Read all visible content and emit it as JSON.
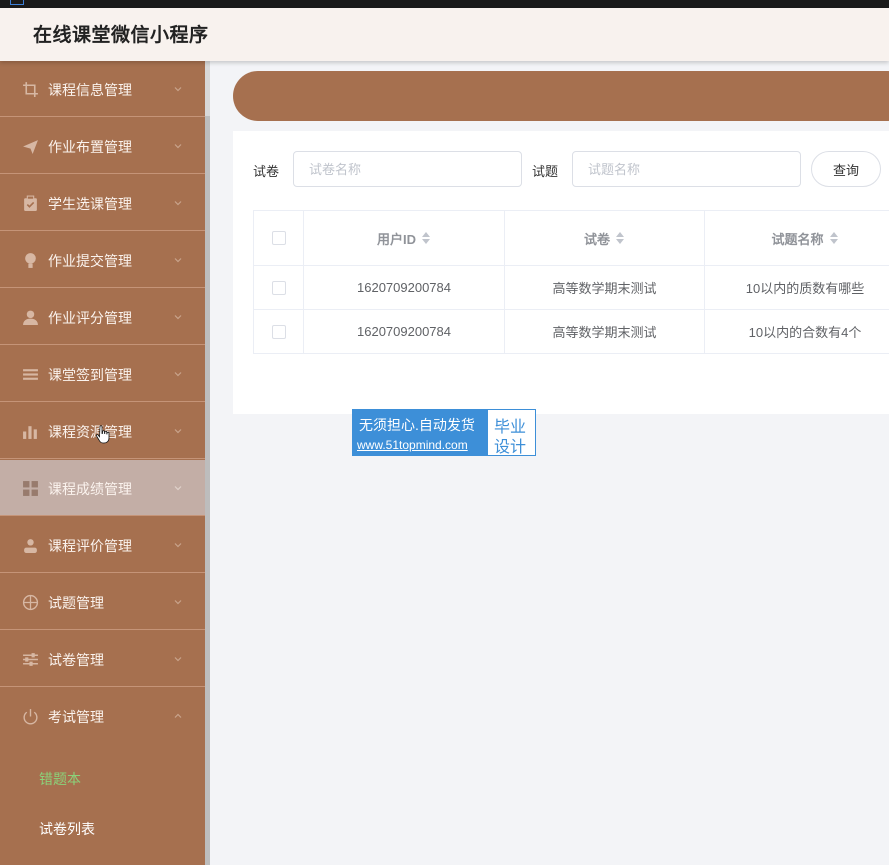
{
  "app": {
    "title": "在线课堂微信小程序"
  },
  "sidebar": {
    "items": [
      {
        "label": "课程信息管理",
        "icon": "crop-icon"
      },
      {
        "label": "作业布置管理",
        "icon": "send-icon"
      },
      {
        "label": "学生选课管理",
        "icon": "clipboard-icon"
      },
      {
        "label": "作业提交管理",
        "icon": "bulb-icon"
      },
      {
        "label": "作业评分管理",
        "icon": "user-icon"
      },
      {
        "label": "课堂签到管理",
        "icon": "list-icon"
      },
      {
        "label": "课程资源管理",
        "icon": "bar-chart-icon"
      },
      {
        "label": "课程成绩管理",
        "icon": "grid-icon"
      },
      {
        "label": "课程评价管理",
        "icon": "person-icon"
      },
      {
        "label": "试题管理",
        "icon": "target-icon"
      },
      {
        "label": "试卷管理",
        "icon": "sliders-icon"
      },
      {
        "label": "考试管理",
        "icon": "power-icon"
      }
    ],
    "sub_items": [
      {
        "label": "错题本"
      },
      {
        "label": "试卷列表"
      }
    ]
  },
  "search": {
    "paper_label": "试卷",
    "paper_placeholder": "试卷名称",
    "question_label": "试题",
    "question_placeholder": "试题名称",
    "query_button": "查询"
  },
  "table": {
    "headers": [
      "用户ID",
      "试卷",
      "试题名称"
    ],
    "rows": [
      [
        "1620709200784",
        "高等数学期末测试",
        "10以内的质数有哪些"
      ],
      [
        "1620709200784",
        "高等数学期末测试",
        "10以内的合数有4个"
      ]
    ]
  },
  "watermark": {
    "line1": "无须担心.自动发货",
    "line2": "www.51topmind.com",
    "right1": "毕业",
    "right2": "设计"
  },
  "colors": {
    "sidebar": "#a6704f",
    "active_item": "#c3aea6",
    "header_bg": "#f8f2ee",
    "current_sub": "#8bd27a",
    "watermark_blue": "#3d8fd8"
  }
}
